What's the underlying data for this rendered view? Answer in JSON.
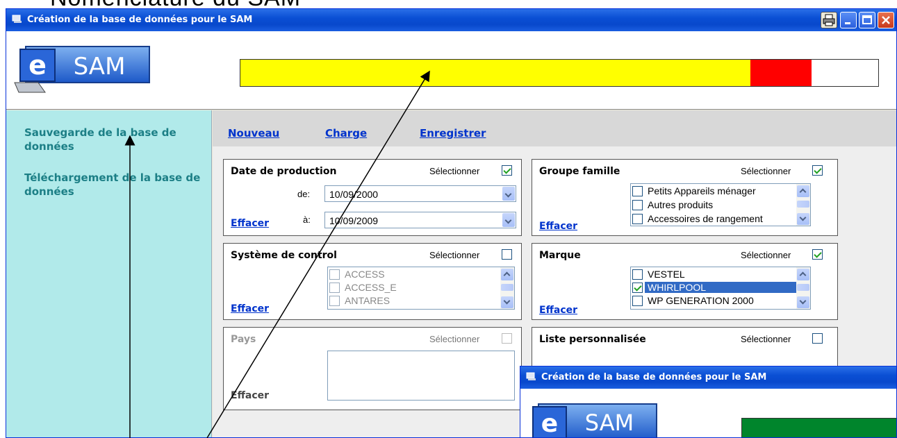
{
  "document": {
    "heading": "Nomenclature du SAM"
  },
  "window": {
    "title": "Création de la base de données pour le SAM",
    "logo_text": "SAM",
    "logo_letter": "e"
  },
  "progress": {
    "segments": [
      {
        "name": "yellow",
        "fraction": 0.8,
        "color": "#ffff00"
      },
      {
        "name": "red",
        "fraction": 0.095,
        "color": "#ff0000"
      },
      {
        "name": "white",
        "fraction": 0.105,
        "color": "#ffffff"
      }
    ]
  },
  "sidebar": {
    "items": [
      {
        "label": "Sauvegarde de la base de données"
      },
      {
        "label": "Téléchargement de la base de données"
      }
    ]
  },
  "toolbar": {
    "nouveau": "Nouveau",
    "charge": "Charge",
    "enregistrer": "Enregistrer"
  },
  "panels": {
    "date": {
      "title": "Date de production",
      "select_label": "Sélectionner",
      "from_label": "de:",
      "to_label": "à:",
      "from_value": "10/09/2000",
      "to_value": "10/09/2009",
      "clear": "Effacer"
    },
    "groupe": {
      "title": "Groupe famille",
      "select_label": "Sélectionner",
      "items": [
        "Petits Appareils ménager",
        "Autres produits",
        "Accessoires de rangement"
      ],
      "clear": "Effacer"
    },
    "systeme": {
      "title": "Système de control",
      "select_label": "Sélectionner",
      "items": [
        "ACCESS",
        "ACCESS_E",
        "ANTARES"
      ],
      "clear": "Effacer"
    },
    "marque": {
      "title": "Marque",
      "select_label": "Sélectionner",
      "items": [
        "VESTEL",
        "WHIRLPOOL",
        "WP GENERATION 2000"
      ],
      "clear": "Effacer"
    },
    "pays": {
      "title": "Pays",
      "select_label": "Sélectionner",
      "clear": "Effacer"
    },
    "liste": {
      "title": "Liste personnalisée",
      "select_label": "Sélectionner"
    }
  },
  "window2": {
    "title": "Création de la base de données pour le SAM",
    "logo_text": "SAM",
    "logo_letter": "e"
  }
}
